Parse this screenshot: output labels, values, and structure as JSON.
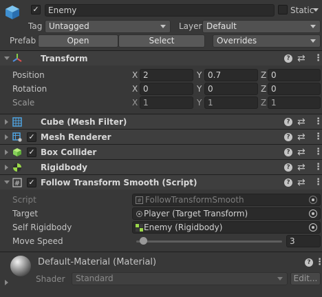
{
  "gameobject": {
    "name": "Enemy",
    "active": true,
    "static_label": "Static",
    "static_checked": false,
    "tag_label": "Tag",
    "tag_value": "Untagged",
    "layer_label": "Layer",
    "layer_value": "Default",
    "prefab_label": "Prefab",
    "prefab_open": "Open",
    "prefab_select": "Select",
    "prefab_overrides": "Overrides"
  },
  "transform": {
    "title": "Transform",
    "position_label": "Position",
    "rotation_label": "Rotation",
    "scale_label": "Scale",
    "axis_x": "X",
    "axis_y": "Y",
    "axis_z": "Z",
    "position": {
      "x": "2",
      "y": "0.7",
      "z": "0"
    },
    "rotation": {
      "x": "0",
      "y": "0",
      "z": "0"
    },
    "scale": {
      "x": "1",
      "y": "1",
      "z": "1"
    }
  },
  "components": {
    "mesh_filter": "Cube (Mesh Filter)",
    "mesh_renderer": "Mesh Renderer",
    "box_collider": "Box Collider",
    "rigidbody": "Rigidbody",
    "script": "Follow Transform Smooth (Script)"
  },
  "script_fields": {
    "script_label": "Script",
    "script_value": "FollowTransformSmooth",
    "target_label": "Target",
    "target_value": "Player (Target Transform)",
    "self_rb_label": "Self Rigidbody",
    "self_rb_value": "Enemy (Rigidbody)",
    "move_speed_label": "Move Speed",
    "move_speed_value": "3",
    "move_speed_slider_fraction": 0.05
  },
  "material": {
    "name": "Default-Material (Material)",
    "shader_label": "Shader",
    "shader_value": "Standard",
    "edit_label": "Edit..."
  },
  "colors": {
    "background": "#383838",
    "header": "#3e3e3e",
    "field": "#2a2a2a",
    "cube_icon": "#4fa3e0",
    "collider_icon": "#86d05a",
    "rigidbody_icon": "#9bd84a"
  }
}
